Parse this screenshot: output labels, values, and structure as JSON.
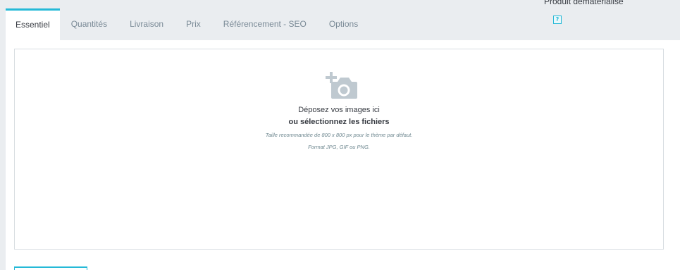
{
  "tabs": [
    {
      "label": "Essentiel",
      "active": true
    },
    {
      "label": "Quantités",
      "active": false
    },
    {
      "label": "Livraison",
      "active": false
    },
    {
      "label": "Prix",
      "active": false
    },
    {
      "label": "Référencement - SEO",
      "active": false
    },
    {
      "label": "Options",
      "active": false
    }
  ],
  "header": {
    "dematerialise_label": "Produit dématérialisé",
    "help_icon": "?"
  },
  "dropzone": {
    "icon": "add-photo-icon",
    "line1": "Déposez vos images ici",
    "line2": "ou sélectionnez les fichiers",
    "line3": "Taille recommandée de 800 x 800 px pour le thème par défaut.",
    "line4": "Format JPG, GIF ou PNG."
  },
  "colors": {
    "accent": "#25b9d7",
    "background": "#eaedf0",
    "text": "#363a41",
    "muted": "#7a8a96"
  }
}
